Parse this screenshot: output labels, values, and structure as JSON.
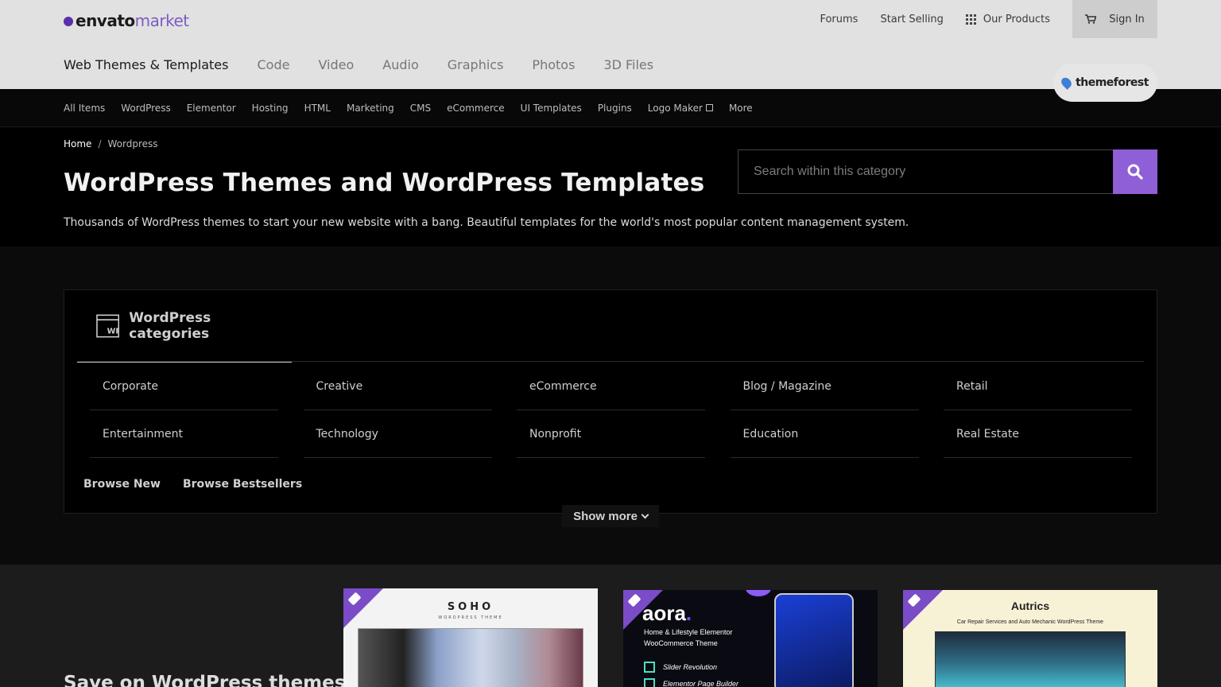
{
  "header": {
    "logo_main": "envato",
    "logo_sub": "market",
    "links": {
      "forums": "Forums",
      "start_selling": "Start Selling",
      "our_products": "Our Products",
      "sign_in": "Sign In"
    },
    "tabs": [
      "Web Themes & Templates",
      "Code",
      "Video",
      "Audio",
      "Graphics",
      "Photos",
      "3D Files"
    ],
    "active_tab": "Web Themes & Templates",
    "brand_badge": "themeforest"
  },
  "subnav": {
    "items": [
      "All Items",
      "WordPress",
      "Elementor",
      "Hosting",
      "HTML",
      "Marketing",
      "CMS",
      "eCommerce",
      "UI Templates",
      "Plugins",
      "Logo Maker",
      "More"
    ]
  },
  "hero": {
    "breadcrumb": {
      "home": "Home",
      "separator": "/",
      "current": "Wordpress"
    },
    "title": "WordPress Themes and WordPress Templates",
    "description": "Thousands of WordPress themes to start your new website with a bang. Beautiful templates for the world's most popular content management system.",
    "search_placeholder": "Search within this category"
  },
  "categories": {
    "panel_title": "WordPress categories",
    "items": [
      "Corporate",
      "Creative",
      "eCommerce",
      "Blog / Magazine",
      "Retail",
      "Entertainment",
      "Technology",
      "Nonprofit",
      "Education",
      "Real Estate"
    ],
    "browse_new": "Browse New",
    "browse_bestsellers": "Browse Bestsellers",
    "show_more": "Show more"
  },
  "promo": {
    "title": "Save on WordPress themes",
    "cards": [
      {
        "name": "SOHO",
        "subtitle": "WORDPRESS THEME"
      },
      {
        "name": "aora",
        "tagline_1": "Home & Lifestyle Elementor",
        "tagline_2": "WooCommerce Theme",
        "feature_1": "Slider Revolution",
        "feature_2": "Elementor Page Builder"
      },
      {
        "name": "Autrics",
        "subtitle": "Car Repair Services and Auto Mechanic WordPress Theme"
      }
    ]
  },
  "colors": {
    "accent": "#8e5fd6",
    "header_bg": "#e1e1e1",
    "page_bg": "#000000"
  }
}
